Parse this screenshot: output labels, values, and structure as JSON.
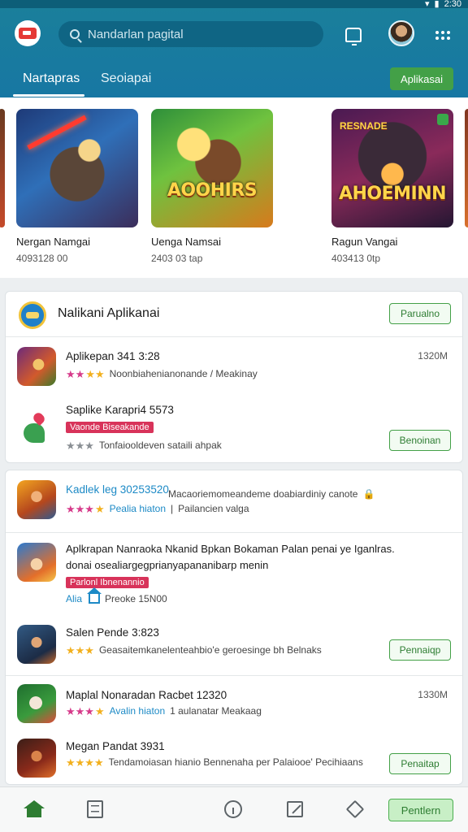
{
  "status_bar": {
    "time": "2:30"
  },
  "header": {
    "search_placeholder": "Nandarlan pagital",
    "tabs": [
      {
        "label": "Nartapras",
        "active": true
      },
      {
        "label": "Seoiapai",
        "active": false
      }
    ],
    "action_button": "Aplikasai",
    "accent_color": "#1a7f9b"
  },
  "carousel": [
    {
      "title": "Nergan Namgai",
      "size": "4093128 00",
      "art_text": ""
    },
    {
      "title": "Uenga Namsai",
      "size": "2403 03 tap",
      "art_text": "AOOHIRS"
    },
    {
      "title": "Ragun Vangai",
      "size": "403413 0tp",
      "art_text": "AHOEMINN",
      "art_top": "RESNADE"
    }
  ],
  "section1": {
    "title": "Nalikani Aplikanai",
    "header_button": "Parualno",
    "items": [
      {
        "title": "Aplikepan 341 3:28",
        "rating_desc": "Noonbiahenianonande / Meakinay",
        "size": "1320M"
      },
      {
        "title": "Saplike Karapri4 5573",
        "tag": "Vaonde Biseakande",
        "desc": "Tonfaiooldeven sataili ahpak",
        "button": "Benoinan"
      }
    ]
  },
  "section2": {
    "items": [
      {
        "title": "Kadlek leg 30253520",
        "desc": "Macaoriemomeandeme doabiardiniy canote",
        "link": "Pealia hiaton",
        "extra": "Pailancien valga"
      },
      {
        "title_line1": "Aplkrapan Nanraoka Nkanid Bpkan Bokaman Palan penai ye Iganlras.",
        "title_line2": "donai osealiargegprianyapananibarp menin",
        "tag": "Parlonl Ibnenannio",
        "link": "Alia",
        "extra": "Preoke 15N00"
      },
      {
        "title": "Salen Pende 3:823",
        "desc": "Geasaitemkanelenteahbio'e geroesinge bh Belnaks",
        "button": "Pennaiqp"
      },
      {
        "title": "Maplal Nonaradan Racbet 12320",
        "link": "Avalin hiaton",
        "extra": "1 aulanatar Meakaag",
        "size": "1330M"
      },
      {
        "title": "Megan Pandat 3931",
        "desc": "Tendamoiasan hianio Bennenaha per Palaiooe' Pecihiaans",
        "button": "Penaitap"
      }
    ]
  },
  "bottom_nav": {
    "button": "Pentlern"
  }
}
